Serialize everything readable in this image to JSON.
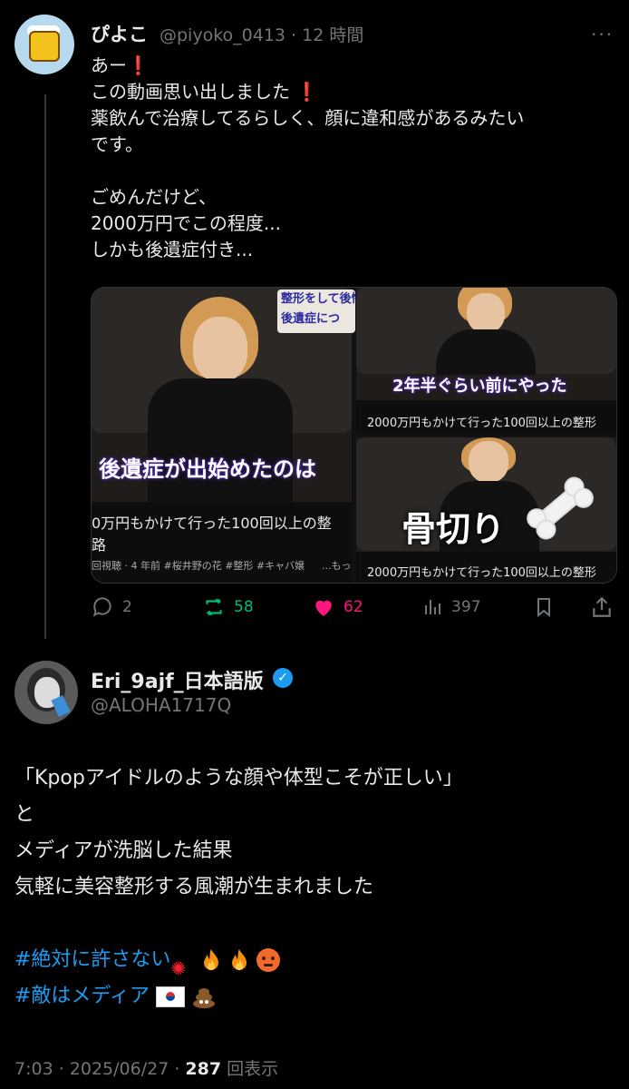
{
  "tweet1": {
    "name": "ぴよこ",
    "handle": "@piyoko_0413",
    "time": "12 時間",
    "lines": [
      "あー",
      "この動画思い出しました",
      "薬飲んで治療してるらしく、顔に違和感があるみたい",
      "です。",
      "",
      "ごめんだけど、",
      "2000万円でこの程度...",
      "しかも後遺症付き..."
    ],
    "media": {
      "big_caption": "後遺症が出始めたのは",
      "big_corner_text_1": "整形をして後悔",
      "big_corner_text_2": "後遺症につ",
      "big_title_1": "0万円もかけて行った100回以上の整",
      "big_title_2": "路",
      "big_meta": "回視聴 · 4 年前  #桜井野の花 #整形 #キャバ嬢",
      "big_more": "...もっ",
      "r1_caption": "2年半ぐらい前にやった",
      "r1_title": "2000万円もかけて行った100回以上の整形",
      "r2_caption": "骨切り",
      "r2_title": "2000万円もかけて行った100回以上の整形"
    },
    "actions": {
      "replies": "2",
      "retweets": "58",
      "likes": "62",
      "views": "397"
    }
  },
  "tweet2": {
    "name": "Eri_9ajf_日本語版",
    "handle": "@ALOHA1717Q",
    "lines": [
      "「Kpopアイドルのような顔や体型こそが正しい」",
      "と",
      "メディアが洗脳した結果",
      "気軽に美容整形する風潮が生まれました",
      ""
    ],
    "hashtag1": "#絶対に許さない",
    "hashtag2": "#敵はメディア",
    "timestamp": "7:03 · 2025/06/27 · ",
    "view_count": "287",
    "view_label": "回表示"
  },
  "colors": {
    "background": "#000000",
    "text": "#e7e9ea",
    "muted": "#71767b",
    "link": "#1d9bf0",
    "retweet": "#00ba7c",
    "like": "#f91880"
  }
}
